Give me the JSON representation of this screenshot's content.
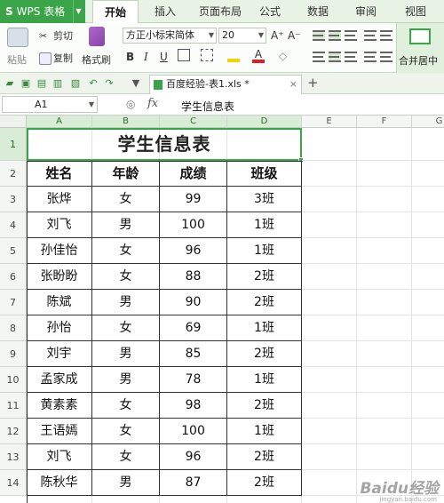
{
  "app": {
    "name": "WPS 表格"
  },
  "menu": {
    "tabs": [
      {
        "label": "开始",
        "active": true
      },
      {
        "label": "插入"
      },
      {
        "label": "页面布局"
      },
      {
        "label": "公式"
      },
      {
        "label": "数据"
      },
      {
        "label": "审阅"
      },
      {
        "label": "视图"
      }
    ]
  },
  "ribbon": {
    "paste": "粘贴",
    "cut": "剪切",
    "copy": "复制",
    "format_painter": "格式刷",
    "font_name": "方正小标宋简体",
    "font_size": "20",
    "bold": "B",
    "italic": "I",
    "underline": "U",
    "grow_font": "A⁺",
    "shrink_font": "A⁻",
    "merge_center": "合并居中"
  },
  "doc": {
    "tab_title": "百度经验-表1.xls *"
  },
  "formula_bar": {
    "cell_ref": "A1",
    "fx": "fx",
    "content": "学生信息表"
  },
  "colors": {
    "accent": "#3aa548",
    "menubar": "#e9f3e5"
  },
  "sheet": {
    "columns": [
      "A",
      "B",
      "C",
      "D",
      "E",
      "F",
      "G"
    ],
    "title": "学生信息表",
    "headers": [
      "姓名",
      "年龄",
      "成绩",
      "班级"
    ],
    "rows": [
      {
        "num": "3",
        "cells": [
          "张烨",
          "女",
          "99",
          "3班"
        ]
      },
      {
        "num": "4",
        "cells": [
          "刘飞",
          "男",
          "100",
          "1班"
        ]
      },
      {
        "num": "5",
        "cells": [
          "孙佳怡",
          "女",
          "96",
          "1班"
        ]
      },
      {
        "num": "6",
        "cells": [
          "张盼盼",
          "女",
          "88",
          "2班"
        ]
      },
      {
        "num": "7",
        "cells": [
          "陈斌",
          "男",
          "90",
          "2班"
        ]
      },
      {
        "num": "8",
        "cells": [
          "孙怡",
          "女",
          "69",
          "1班"
        ]
      },
      {
        "num": "9",
        "cells": [
          "刘宇",
          "男",
          "85",
          "2班"
        ]
      },
      {
        "num": "10",
        "cells": [
          "孟家成",
          "男",
          "78",
          "1班"
        ]
      },
      {
        "num": "11",
        "cells": [
          "黄素素",
          "女",
          "98",
          "2班"
        ]
      },
      {
        "num": "12",
        "cells": [
          "王语嫣",
          "女",
          "100",
          "1班"
        ]
      },
      {
        "num": "13",
        "cells": [
          "刘飞",
          "女",
          "96",
          "2班"
        ]
      },
      {
        "num": "14",
        "cells": [
          "陈秋华",
          "男",
          "87",
          "2班"
        ]
      }
    ]
  },
  "watermark": {
    "text": "Baidu经验",
    "sub": "jingyan.baidu.com"
  }
}
